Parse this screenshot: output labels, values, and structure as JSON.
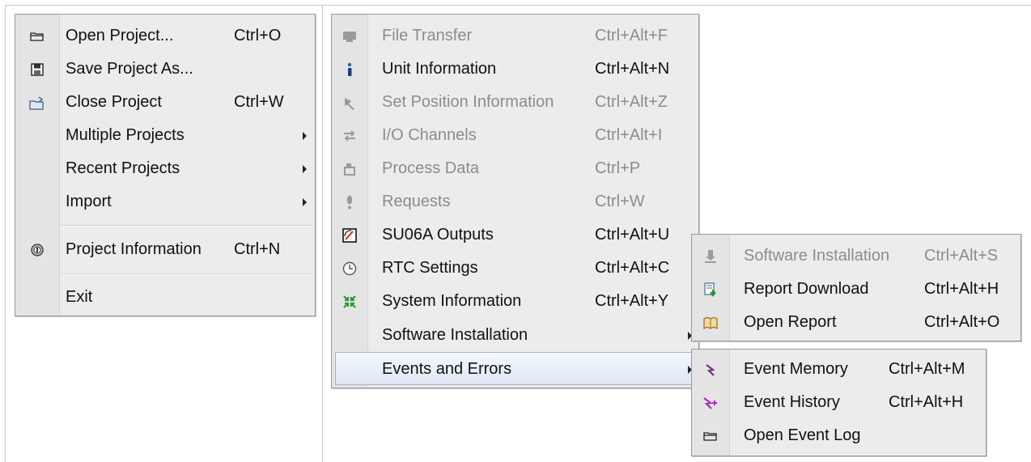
{
  "colors": {
    "menu_bg": "#ececec",
    "disabled_text": "#8c8c8c",
    "highlight": "#dde8f4"
  },
  "file_menu": {
    "items": [
      {
        "label": "Open Project...",
        "shortcut": "Ctrl+O",
        "icon": "folder-open-icon"
      },
      {
        "label": "Save Project As...",
        "shortcut": "",
        "icon": "save-floppy-icon"
      },
      {
        "label": "Close Project",
        "shortcut": "Ctrl+W",
        "icon": "folder-close-icon"
      },
      {
        "label": "Multiple Projects",
        "shortcut": "",
        "submenu": true
      },
      {
        "label": "Recent Projects",
        "shortcut": "",
        "submenu": true
      },
      {
        "label": "Import",
        "shortcut": "",
        "submenu": true
      },
      {
        "label": "Project Information",
        "shortcut": "Ctrl+N",
        "icon": "project-info-icon"
      },
      {
        "label": "Exit",
        "shortcut": ""
      }
    ]
  },
  "unit_menu": {
    "items": [
      {
        "label": "File Transfer",
        "shortcut": "Ctrl+Alt+F",
        "disabled": true,
        "icon": "file-transfer-icon"
      },
      {
        "label": "Unit Information",
        "shortcut": "Ctrl+Alt+N",
        "icon": "info-icon"
      },
      {
        "label": "Set Position Information",
        "shortcut": "Ctrl+Alt+Z",
        "disabled": true,
        "icon": "pin-icon"
      },
      {
        "label": "I/O Channels",
        "shortcut": "Ctrl+Alt+I",
        "disabled": true,
        "icon": "io-arrows-icon"
      },
      {
        "label": "Process Data",
        "shortcut": "Ctrl+P",
        "disabled": true,
        "icon": "process-data-icon"
      },
      {
        "label": "Requests",
        "shortcut": "Ctrl+W",
        "disabled": true,
        "icon": "exclamation-icon"
      },
      {
        "label": "SU06A Outputs",
        "shortcut": "Ctrl+Alt+U",
        "icon": "gauge-icon"
      },
      {
        "label": "RTC Settings",
        "shortcut": "Ctrl+Alt+C",
        "icon": "clock-icon"
      },
      {
        "label": "System Information",
        "shortcut": "Ctrl+Alt+Y",
        "icon": "system-arrows-icon"
      },
      {
        "label": "Software Installation",
        "shortcut": "",
        "submenu": true
      },
      {
        "label": "Events and Errors",
        "shortcut": "",
        "submenu": true,
        "highlighted": true
      }
    ]
  },
  "software_menu": {
    "items": [
      {
        "label": "Software Installation",
        "shortcut": "Ctrl+Alt+S",
        "disabled": true,
        "icon": "install-icon"
      },
      {
        "label": "Report Download",
        "shortcut": "Ctrl+Alt+H",
        "icon": "report-download-icon"
      },
      {
        "label": "Open Report",
        "shortcut": "Ctrl+Alt+O",
        "icon": "open-report-icon"
      }
    ]
  },
  "events_menu": {
    "items": [
      {
        "label": "Event Memory",
        "shortcut": "Ctrl+Alt+M",
        "icon": "event-memory-icon"
      },
      {
        "label": "Event History",
        "shortcut": "Ctrl+Alt+H",
        "icon": "event-history-icon"
      },
      {
        "label": "Open Event Log",
        "shortcut": "",
        "icon": "folder-open-icon"
      }
    ]
  }
}
